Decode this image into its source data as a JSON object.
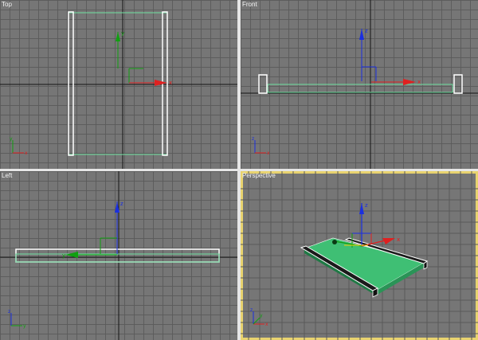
{
  "viewports": [
    {
      "name": "viewport-top",
      "label": "Top",
      "active": false
    },
    {
      "name": "viewport-front",
      "label": "Front",
      "active": false
    },
    {
      "name": "viewport-left",
      "label": "Left",
      "active": false
    },
    {
      "name": "viewport-perspective",
      "label": "Perspective",
      "active": true
    }
  ],
  "axes": {
    "x": "x",
    "y": "y",
    "z": "z"
  },
  "colors": {
    "viewport_bg": "#767676",
    "grid_line": "#5a5a5a",
    "world_axis_line": "#141414",
    "selection_white": "#ffffff",
    "object_green": "#3fbf74",
    "object_green_dark": "#1f7a45",
    "gizmo_x": "#e02020",
    "gizmo_y": "#10a010",
    "gizmo_z": "#1a2fe0",
    "active_border": "#e8d36f"
  }
}
